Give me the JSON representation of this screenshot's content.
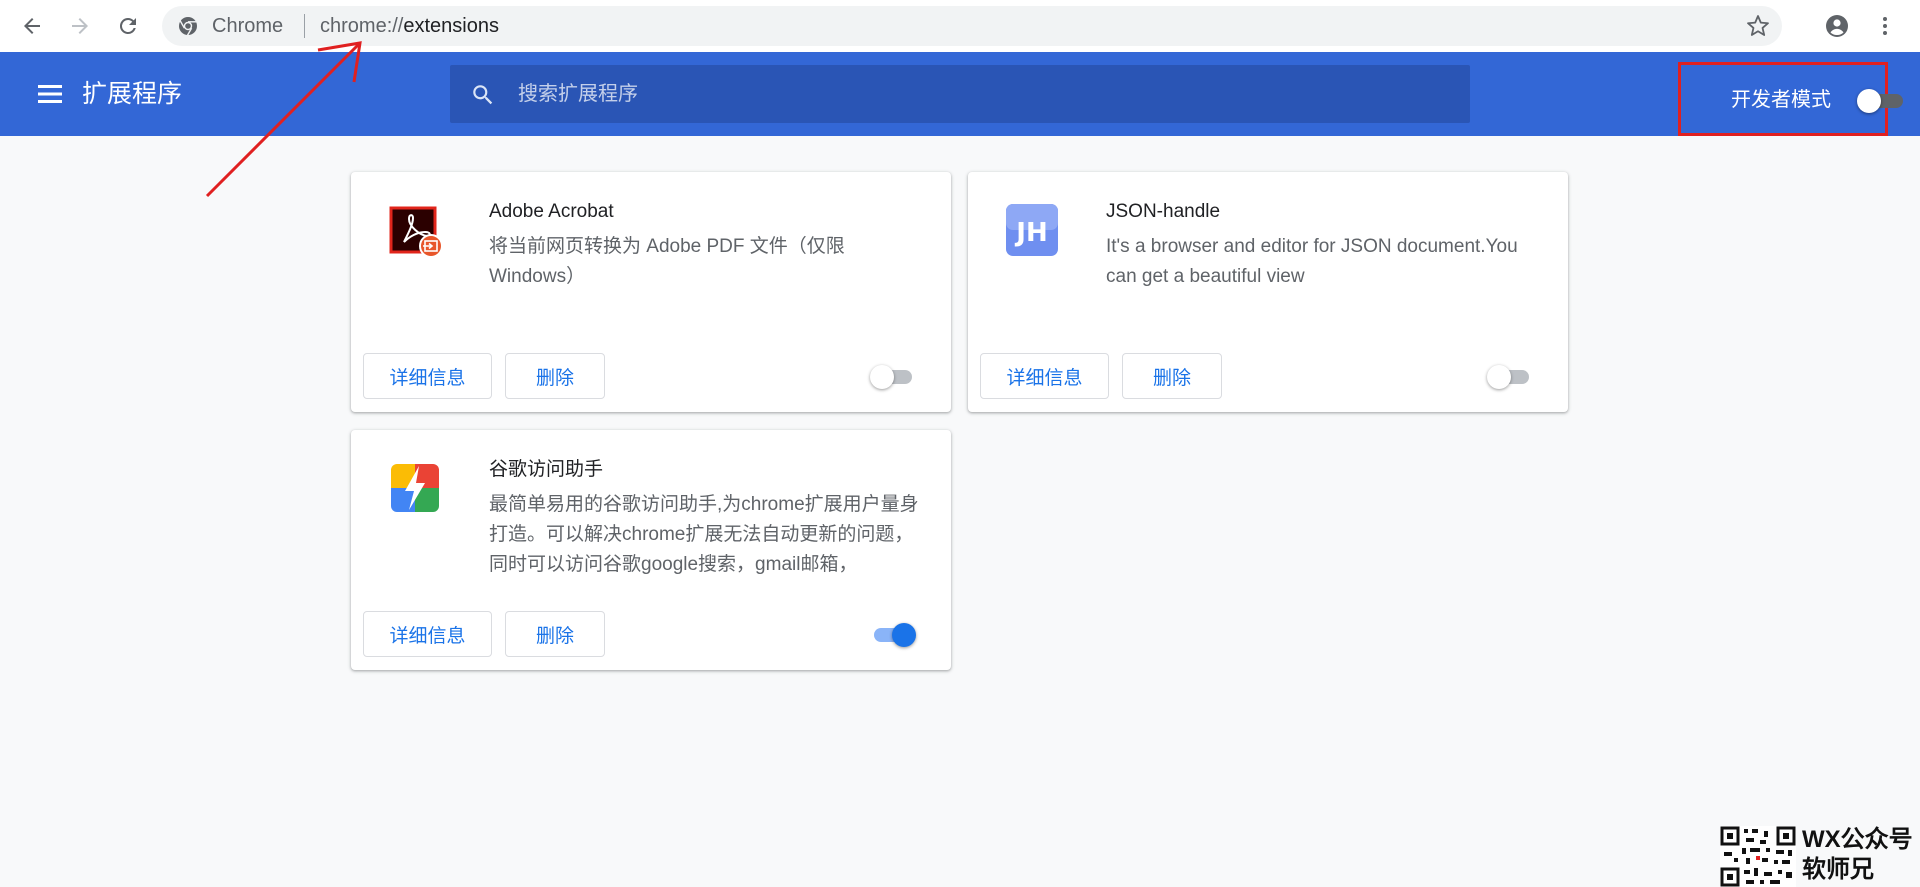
{
  "browser": {
    "omnibox_label": "Chrome",
    "url_scheme": "chrome://",
    "url_path": "extensions",
    "icons": [
      "back-arrow-icon",
      "forward-arrow-icon",
      "reload-icon",
      "chrome-logo-icon",
      "star-icon",
      "account-icon",
      "more-vert-icon"
    ]
  },
  "header": {
    "title": "扩展程序",
    "search_placeholder": "搜索扩展程序",
    "dev_mode_label": "开发者模式",
    "dev_mode_on": false,
    "accent_color": "#3367d6"
  },
  "cards": [
    {
      "name": "Adobe Acrobat",
      "description": "将当前网页转换为 Adobe PDF 文件（仅限 Windows）",
      "details_label": "详细信息",
      "remove_label": "删除",
      "enabled": false,
      "icon": "adobe-acrobat-icon"
    },
    {
      "name": "JSON-handle",
      "description": "It's a browser and editor for JSON document.You can get a beautiful view",
      "details_label": "详细信息",
      "remove_label": "删除",
      "enabled": false,
      "icon": "json-handle-icon",
      "icon_text": "JH"
    },
    {
      "name": "谷歌访问助手",
      "description": "最简单易用的谷歌访问助手,为chrome扩展用户量身打造。可以解决chrome扩展无法自动更新的问题，同时可以访问谷歌google搜索，gmail邮箱，",
      "details_label": "详细信息",
      "remove_label": "删除",
      "enabled": true,
      "icon": "google-access-helper-icon"
    }
  ],
  "watermark": {
    "line1": "WX公众号",
    "line2": "软师兄"
  }
}
